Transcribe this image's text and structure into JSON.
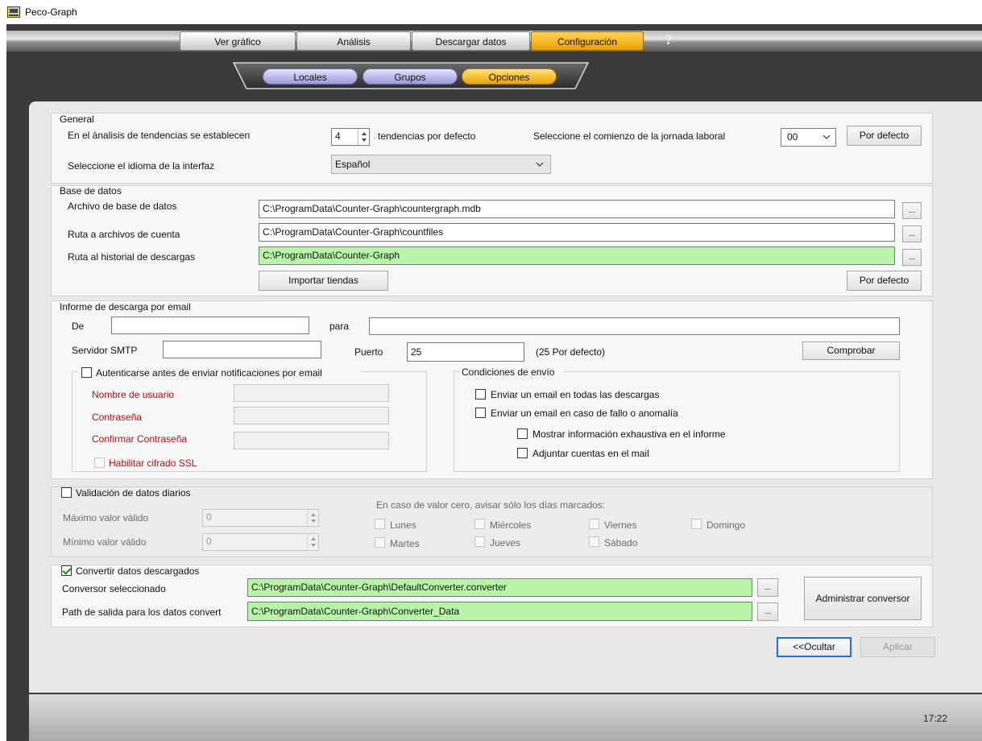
{
  "window": {
    "title": "Peco-Graph"
  },
  "main_tabs": [
    {
      "label": "Ver gráfico",
      "active": false
    },
    {
      "label": "Análisis",
      "active": false
    },
    {
      "label": "Descargar datos",
      "active": false
    },
    {
      "label": "Configuración",
      "active": true
    }
  ],
  "help_label": "?",
  "sub_tabs": [
    {
      "label": "Locales",
      "active": false
    },
    {
      "label": "Grupos",
      "active": false
    },
    {
      "label": "Opciones",
      "active": true
    }
  ],
  "general": {
    "title": "General",
    "trends_prefix": "En el ánalisis de tendencias se establecen",
    "trends_value": "4",
    "trends_suffix": "tendencias por defecto",
    "workday_label": "Seleccione el comienzo de la jornada laboral",
    "workday_value": "00",
    "default_button": "Por defecto",
    "language_label": "Seleccione el idioma de la interfaz",
    "language_value": "Español"
  },
  "database": {
    "title": "Base de datos",
    "db_file_label": "Archivo de base de datos",
    "db_file_value": "C:\\ProgramData\\Counter-Graph\\countergraph.mdb",
    "count_path_label": "Ruta a archivos de cuenta",
    "count_path_value": "C:\\ProgramData\\Counter-Graph\\countfiles",
    "history_label": "Ruta al historial de descargas",
    "history_value": "C:\\ProgramData\\Counter-Graph",
    "browse_label": "...",
    "import_button": "Importar tiendas",
    "default_button": "Por defecto"
  },
  "email": {
    "title": "Informe de descarga por email",
    "from_label": "De",
    "from_value": "",
    "to_label": "para",
    "to_value": "",
    "smtp_label": "Servidor SMTP",
    "smtp_value": "",
    "port_label": "Puerto",
    "port_value": "25",
    "port_hint": "(25 Por defecto)",
    "check_button": "Comprobar",
    "auth_label": "Autenticarse antes de enviar notificaciones por email",
    "auth_checked": false,
    "username_label": "Nombre de usuario",
    "password_label": "Contraseña",
    "confirm_label": "Confirmar Contraseña",
    "ssl_label": "Habilitar cifrado SSL",
    "conditions_title": "Condiciones de envío",
    "cond_all": "Enviar un email en todas las descargas",
    "cond_fail": "Enviar un email en caso de fallo o anomalía",
    "cond_detail": "Mostrar información exhaustiva en el informe",
    "cond_attach": "Adjuntar cuentas en el mail"
  },
  "validation": {
    "title": "Validación de datos diarios",
    "checked": false,
    "max_label": "Máximo valor válido",
    "max_value": "0",
    "min_label": "Mínimo valor válido",
    "min_value": "0",
    "zero_label": "En caso de valor cero, avisar sólo los días marcados:",
    "days": [
      "Lunes",
      "Miércoles",
      "Viernes",
      "Domingo",
      "Martes",
      "Jueves",
      "Sábado"
    ]
  },
  "convert": {
    "title": "Convertir datos descargados",
    "checked": true,
    "converter_label": "Conversor seleccionado",
    "converter_value": "C:\\ProgramData\\Counter-Graph\\DefaultConverter.converter",
    "output_label": "Path de salida para los datos convert",
    "output_value": "C:\\ProgramData\\Counter-Graph\\Converter_Data",
    "manage_button": "Administrar conversor"
  },
  "footer": {
    "hide_button": "<<Ocultar",
    "apply_button": "Aplicar"
  },
  "status": {
    "clock": "17:22"
  },
  "colors": {
    "accent_tab": "#f6b51e",
    "subtab": "#b7b7ea",
    "green_field": "#b8f5a8",
    "red_label": "#b01010",
    "focus_border": "#2a6bd6"
  }
}
